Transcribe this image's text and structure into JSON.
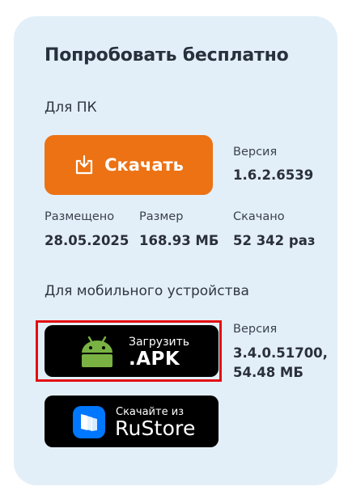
{
  "title": "Попробовать бесплатно",
  "pc": {
    "label": "Для ПК",
    "download_label": "Скачать",
    "version_label": "Версия",
    "version_value": "1.6.2.6539",
    "stats": [
      {
        "label": "Размещено",
        "value": "28.05.2025"
      },
      {
        "label": "Размер",
        "value": "168.93 МБ"
      },
      {
        "label": "Скачано",
        "value": "52 342 раз"
      }
    ]
  },
  "mobile": {
    "label": "Для мобильного устройства",
    "apk_small": "Загрузить",
    "apk_big": ".APK",
    "rustore_small": "Скачайте из",
    "rustore_big": "RuStore",
    "version_label": "Версия",
    "version_value_line1": "3.4.0.51700,",
    "version_value_line2": "54.48 МБ"
  },
  "colors": {
    "card_bg": "#e3eff8",
    "download_btn": "#ec7214",
    "highlight": "#e30d12",
    "android_green": "#79b243",
    "rustore_blue": "#0077ff"
  },
  "icons": {
    "download": "download-icon",
    "android": "android-logo-icon",
    "rustore": "rustore-logo-icon"
  }
}
